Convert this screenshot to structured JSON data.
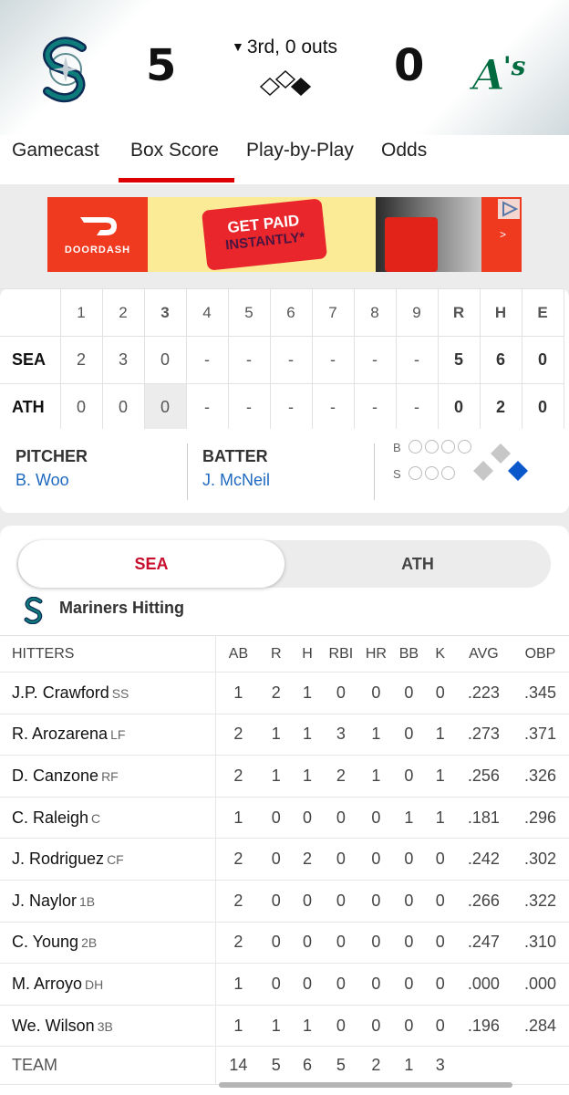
{
  "game": {
    "away": {
      "abbr": "SEA",
      "score": "5"
    },
    "home": {
      "abbr": "ATH",
      "score": "0"
    },
    "inning_arrow": "▼",
    "inning": "3rd, 0 outs"
  },
  "tabs": [
    "Gamecast",
    "Box Score",
    "Play-by-Play",
    "Odds"
  ],
  "active_tab": "Box Score",
  "ad": {
    "brand": "DOORDASH",
    "cta_line1": "GET PAID",
    "cta_line2": "INSTANTLY*",
    "arrow": ">"
  },
  "linescore": {
    "headers": [
      "1",
      "2",
      "3",
      "4",
      "5",
      "6",
      "7",
      "8",
      "9",
      "R",
      "H",
      "E"
    ],
    "rows": [
      {
        "team": "SEA",
        "innings": [
          "2",
          "3",
          "0",
          "-",
          "-",
          "-",
          "-",
          "-",
          "-"
        ],
        "r": "5",
        "h": "6",
        "e": "0"
      },
      {
        "team": "ATH",
        "innings": [
          "0",
          "0",
          "0",
          "-",
          "-",
          "-",
          "-",
          "-",
          "-"
        ],
        "r": "0",
        "h": "2",
        "e": "0"
      }
    ],
    "current_inning": "3"
  },
  "situation": {
    "pitcher_label": "PITCHER",
    "pitcher": "B. Woo",
    "batter_label": "BATTER",
    "batter": "J. McNeil",
    "balls_label": "B",
    "strikes_label": "S",
    "balls": 0,
    "strikes": 0,
    "runners": {
      "first": false,
      "second": false,
      "third": false
    }
  },
  "boxscore": {
    "segments": [
      "SEA",
      "ATH"
    ],
    "active_segment": "SEA",
    "section_title": "Mariners Hitting",
    "columns": [
      "HITTERS",
      "AB",
      "R",
      "H",
      "RBI",
      "HR",
      "BB",
      "K",
      "AVG",
      "OBP"
    ],
    "hitters": [
      {
        "name": "J.P. Crawford",
        "pos": "SS",
        "ab": "1",
        "r": "2",
        "h": "1",
        "rbi": "0",
        "hr": "0",
        "bb": "0",
        "k": "0",
        "avg": ".223",
        "obp": ".345"
      },
      {
        "name": "R. Arozarena",
        "pos": "LF",
        "ab": "2",
        "r": "1",
        "h": "1",
        "rbi": "3",
        "hr": "1",
        "bb": "0",
        "k": "1",
        "avg": ".273",
        "obp": ".371"
      },
      {
        "name": "D. Canzone",
        "pos": "RF",
        "ab": "2",
        "r": "1",
        "h": "1",
        "rbi": "2",
        "hr": "1",
        "bb": "0",
        "k": "1",
        "avg": ".256",
        "obp": ".326"
      },
      {
        "name": "C. Raleigh",
        "pos": "C",
        "ab": "1",
        "r": "0",
        "h": "0",
        "rbi": "0",
        "hr": "0",
        "bb": "1",
        "k": "1",
        "avg": ".181",
        "obp": ".296"
      },
      {
        "name": "J. Rodriguez",
        "pos": "CF",
        "ab": "2",
        "r": "0",
        "h": "2",
        "rbi": "0",
        "hr": "0",
        "bb": "0",
        "k": "0",
        "avg": ".242",
        "obp": ".302"
      },
      {
        "name": "J. Naylor",
        "pos": "1B",
        "ab": "2",
        "r": "0",
        "h": "0",
        "rbi": "0",
        "hr": "0",
        "bb": "0",
        "k": "0",
        "avg": ".266",
        "obp": ".322"
      },
      {
        "name": "C. Young",
        "pos": "2B",
        "ab": "2",
        "r": "0",
        "h": "0",
        "rbi": "0",
        "hr": "0",
        "bb": "0",
        "k": "0",
        "avg": ".247",
        "obp": ".310"
      },
      {
        "name": "M. Arroyo",
        "pos": "DH",
        "ab": "1",
        "r": "0",
        "h": "0",
        "rbi": "0",
        "hr": "0",
        "bb": "0",
        "k": "0",
        "avg": ".000",
        "obp": ".000"
      },
      {
        "name": "We. Wilson",
        "pos": "3B",
        "ab": "1",
        "r": "1",
        "h": "1",
        "rbi": "0",
        "hr": "0",
        "bb": "0",
        "k": "0",
        "avg": ".196",
        "obp": ".284"
      }
    ],
    "team_totals": {
      "name": "TEAM",
      "ab": "14",
      "r": "5",
      "h": "6",
      "rbi": "5",
      "hr": "2",
      "bb": "1",
      "k": "3",
      "avg": "",
      "obp": ""
    }
  },
  "colors": {
    "accent": "#d00000",
    "link": "#1f6ac0",
    "mariners_navy": "#0c2c56",
    "mariners_teal": "#005c5c",
    "athletics_green": "#003831"
  }
}
